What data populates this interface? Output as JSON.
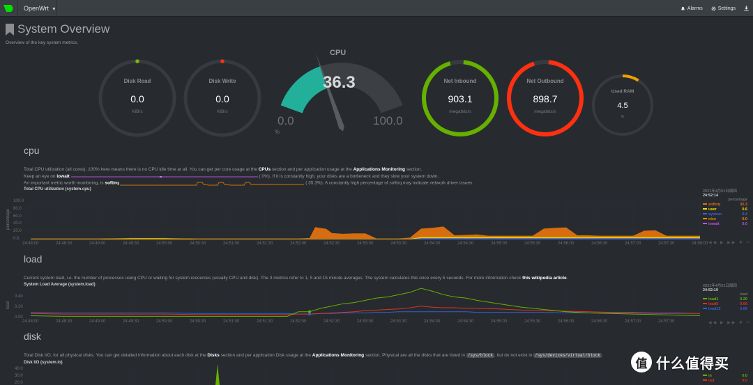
{
  "navbar": {
    "brand": "OpenWrt",
    "alarms_label": "Alarms",
    "settings_label": "Settings",
    "logo_color": "#00e000"
  },
  "page": {
    "title": "System Overview",
    "subtitle": "Overview of the key system metrics."
  },
  "gauges": {
    "disk_read": {
      "label": "Disk Read",
      "value": "0.0",
      "unit": "KiB/s",
      "color": "#7ab800"
    },
    "disk_write": {
      "label": "Disk Write",
      "value": "0.0",
      "unit": "KiB/s",
      "color": "#ff3010"
    },
    "cpu": {
      "label": "CPU",
      "value": "36.3",
      "min": "0.0",
      "max": "100.0",
      "unit": "%",
      "percent": 36.3,
      "color": "#22b09a"
    },
    "net_inbound": {
      "label": "Net Inbound",
      "value": "903.1",
      "unit": "megabits/s",
      "fraction": 0.97,
      "color": "#66b000"
    },
    "net_outbound": {
      "label": "Net Outbound",
      "value": "898.7",
      "unit": "megabits/s",
      "fraction": 0.965,
      "color": "#ff3010"
    },
    "used_ram": {
      "label": "Used RAM",
      "value": "4.5",
      "unit": "%",
      "fraction": 0.045,
      "color": "#f0a000"
    }
  },
  "cpu_section": {
    "title": "cpu",
    "desc1_a": "Total CPU utilization (all cores). 100% here means there is no CPU idle time at all. You can get per core usage at the ",
    "desc1_b": "CPUs",
    "desc1_c": " section and per application usage at the ",
    "desc1_d": "Applications Monitoring",
    "desc1_e": " section.",
    "desc2_a": "Keep an eye on ",
    "desc2_b": "iowait",
    "desc2_c": "(        0%). If it is constantly high, your disks are a bottleneck and they slow your system down.",
    "desc3_a": "An important metric worth monitoring, is ",
    "desc3_b": "softirq",
    "desc3_c": "(        35.3%). A constantly high percentage of softirq may indicate network driver issues.",
    "chart_title": "Total CPU utilization (system.cpu)",
    "ylabel": "percentage",
    "yticks": [
      "100.0",
      "80.0",
      "60.0",
      "40.0",
      "20.0",
      "0.0"
    ],
    "xticks": [
      "24:48:00",
      "24:48:30",
      "24:49:00",
      "24:49:30",
      "24:50:00",
      "24:50:30",
      "24:51:00",
      "24:51:30",
      "24:52:00",
      "24:52:30",
      "24:53:00",
      "24:53:30",
      "24:54:00",
      "24:54:30",
      "24:55:00",
      "24:55:30",
      "24:56:00",
      "24:56:30",
      "24:57:00",
      "24:57:30",
      "24:58:00"
    ],
    "legend": {
      "date": "2021年4月01日周四",
      "time": "24:52:14",
      "unit": "percentage",
      "items": [
        {
          "name": "softirq",
          "value": "35.3",
          "color": "#e07010"
        },
        {
          "name": "user",
          "value": "0.6",
          "color": "#f0e000"
        },
        {
          "name": "system",
          "value": "0.4",
          "color": "#4060e0"
        },
        {
          "name": "nice",
          "value": "0.0",
          "color": "#f08a00"
        },
        {
          "name": "iowait",
          "value": "0.0",
          "color": "#c050e0"
        }
      ]
    }
  },
  "load_section": {
    "title": "load",
    "desc_a": "Current system load, i.e. the number of processes using CPU or waiting for system resources (usually CPU and disk). The 3 metrics refer to 1, 5 and 15 minute averages. The system calculates this once every 5 seconds. For more information check ",
    "desc_b": "this wikipedia article",
    "desc_c": ".",
    "chart_title": "System Load Average (system.load)",
    "ylabel": "load",
    "yticks": [
      "0.40",
      "0.20",
      "0.00"
    ],
    "xticks": [
      "24:48:00",
      "24:48:30",
      "24:49:00",
      "24:49:30",
      "24:50:00",
      "24:50:30",
      "24:51:00",
      "24:51:30",
      "24:52:00",
      "24:52:30",
      "24:53:00",
      "24:53:30",
      "24:54:00",
      "24:54:30",
      "24:55:00",
      "24:55:30",
      "24:56:00",
      "24:56:30",
      "24:57:00",
      "24:57:30"
    ],
    "legend": {
      "date": "2021年4月01日周四",
      "time": "24:52:10",
      "unit": "load",
      "items": [
        {
          "name": "load1",
          "value": "0.20",
          "color": "#66b000"
        },
        {
          "name": "load5",
          "value": "0.06",
          "color": "#e03020"
        },
        {
          "name": "load15",
          "value": "0.06",
          "color": "#3060d0"
        }
      ]
    }
  },
  "disk_section": {
    "title": "disk",
    "desc_a": "Total Disk I/O, for all physical disks. You can get detailed information about each disk at the ",
    "desc_b": "Disks",
    "desc_c": " section and per application Disk usage at the ",
    "desc_d": "Applications Monitoring",
    "desc_e": " section. Physical are all the disks that are listed in ",
    "desc_code1": "/sys/block",
    "desc_f": ", but do not exist in ",
    "desc_code2": "/sys/devices/virtual/block",
    "desc_g": ".",
    "chart_title": "Disk I/O (system.io)",
    "yticks": [
      "40.0",
      "30.0",
      "20.0"
    ],
    "legend": {
      "items": [
        {
          "name": "in",
          "value": "0.0",
          "color": "#66b000"
        },
        {
          "name": "out",
          "value": "0.0",
          "color": "#e03020"
        }
      ]
    }
  },
  "watermark": {
    "glyph": "值",
    "text": "什么值得买"
  },
  "chart_data": [
    {
      "type": "area",
      "title": "Total CPU utilization (system.cpu)",
      "ylabel": "percentage",
      "ylim": [
        0,
        100
      ],
      "xrange": [
        "24:48:00",
        "24:58:00"
      ],
      "x_seconds": [
        0,
        30,
        60,
        90,
        120,
        150,
        180,
        210,
        240,
        250,
        255,
        260,
        265,
        270,
        280,
        290,
        300,
        310,
        320,
        330,
        340,
        350,
        360,
        370,
        380,
        390,
        400,
        410,
        420,
        430,
        440,
        450,
        460,
        470,
        480,
        490,
        500,
        510,
        520,
        530,
        540,
        550,
        560,
        570,
        580,
        590,
        600
      ],
      "series": [
        {
          "name": "softirq",
          "values": [
            1,
            1,
            1,
            1,
            1,
            1,
            1,
            1,
            1,
            2,
            28,
            26,
            24,
            14,
            12,
            13,
            13,
            1,
            1,
            1,
            3,
            20,
            22,
            25,
            4,
            5,
            6,
            3,
            3,
            3,
            3,
            3,
            20,
            22,
            23,
            4,
            4,
            3,
            3,
            3,
            3,
            15,
            16,
            3,
            3,
            3,
            3
          ]
        },
        {
          "name": "user",
          "values": [
            1,
            1,
            1,
            2,
            2,
            1,
            1,
            1,
            1,
            1,
            1,
            1,
            1,
            1,
            1,
            1,
            1,
            1,
            1,
            1,
            1,
            3,
            3,
            3,
            3,
            3,
            3,
            3,
            3,
            3,
            3,
            3,
            3,
            3,
            3,
            3,
            3,
            3,
            3,
            3,
            3,
            3,
            3,
            3,
            3,
            3,
            3
          ]
        },
        {
          "name": "system",
          "values": [
            0.5,
            0.5,
            0.5,
            0.5,
            0.5,
            0.5,
            0.5,
            0.5,
            0.5,
            0.5,
            0.5,
            0.5,
            0.5,
            0.5,
            0.5,
            0.5,
            0.5,
            0.5,
            0.5,
            0.5,
            0.5,
            3,
            3,
            3,
            3,
            3,
            3,
            3,
            3,
            3,
            3,
            3,
            3,
            3,
            3,
            3,
            3,
            3,
            3,
            3,
            3,
            3,
            3,
            3,
            3,
            3,
            3
          ]
        },
        {
          "name": "nice",
          "values": [
            0,
            0,
            0,
            0,
            0,
            0,
            0,
            0,
            0,
            0,
            0,
            0,
            0,
            0,
            0,
            0,
            0,
            0,
            0,
            0,
            0,
            0,
            0,
            0,
            0,
            0,
            0,
            0,
            0,
            0,
            0,
            0,
            0,
            0,
            0,
            0,
            0,
            0,
            0,
            0,
            0,
            0,
            0,
            0,
            0,
            0,
            0
          ]
        },
        {
          "name": "iowait",
          "values": [
            0,
            0,
            0,
            0,
            0,
            0,
            0,
            0,
            0,
            0,
            0,
            0,
            0,
            0,
            0,
            0,
            0,
            0,
            0,
            0,
            0,
            0,
            0,
            0,
            0,
            0,
            0,
            0,
            0,
            0,
            0,
            0,
            0,
            0,
            0,
            0,
            0,
            0,
            0,
            0,
            0,
            0,
            0,
            0,
            0,
            0,
            0
          ]
        }
      ]
    },
    {
      "type": "line",
      "title": "System Load Average (system.load)",
      "ylabel": "load",
      "ylim": [
        0,
        0.5
      ],
      "xrange": [
        "24:48:00",
        "24:58:00"
      ],
      "x_seconds": [
        0,
        30,
        60,
        90,
        120,
        150,
        180,
        210,
        230,
        240,
        250,
        260,
        270,
        280,
        290,
        300,
        310,
        320,
        330,
        340,
        350,
        360,
        370,
        380,
        390,
        400,
        420,
        440,
        460,
        480,
        500,
        520,
        540,
        560,
        580,
        600
      ],
      "series": [
        {
          "name": "load1",
          "values": [
            0.03,
            0.02,
            0.02,
            0.02,
            0.02,
            0.02,
            0.02,
            0.02,
            0.02,
            0.1,
            0.1,
            0.16,
            0.2,
            0.24,
            0.26,
            0.3,
            0.34,
            0.36,
            0.4,
            0.44,
            0.51,
            0.46,
            0.4,
            0.36,
            0.34,
            0.3,
            0.24,
            0.18,
            0.14,
            0.1,
            0.08,
            0.07,
            0.06,
            0.05,
            0.04,
            0.03
          ]
        },
        {
          "name": "load5",
          "values": [
            0.07,
            0.06,
            0.06,
            0.06,
            0.06,
            0.05,
            0.05,
            0.05,
            0.05,
            0.06,
            0.06,
            0.07,
            0.08,
            0.09,
            0.1,
            0.12,
            0.13,
            0.14,
            0.15,
            0.17,
            0.2,
            0.18,
            0.17,
            0.17,
            0.16,
            0.16,
            0.15,
            0.13,
            0.12,
            0.11,
            0.1,
            0.09,
            0.09,
            0.08,
            0.08,
            0.07
          ]
        },
        {
          "name": "load15",
          "values": [
            0.09,
            0.08,
            0.08,
            0.08,
            0.08,
            0.07,
            0.07,
            0.07,
            0.07,
            0.06,
            0.06,
            0.07,
            0.07,
            0.08,
            0.08,
            0.08,
            0.09,
            0.09,
            0.1,
            0.1,
            0.1,
            0.1,
            0.1,
            0.1,
            0.1,
            0.09,
            0.09,
            0.09,
            0.09,
            0.08,
            0.08,
            0.08,
            0.08,
            0.07,
            0.07,
            0.07
          ]
        }
      ]
    },
    {
      "type": "line",
      "title": "Disk I/O (system.io)",
      "ylim": [
        0,
        40
      ],
      "series": [
        {
          "name": "in",
          "values": [
            0,
            0,
            0,
            0,
            0,
            40,
            0,
            0,
            0,
            0
          ]
        },
        {
          "name": "out",
          "values": [
            0,
            0,
            0,
            0,
            0,
            0,
            0,
            0,
            0,
            0
          ]
        }
      ]
    }
  ]
}
